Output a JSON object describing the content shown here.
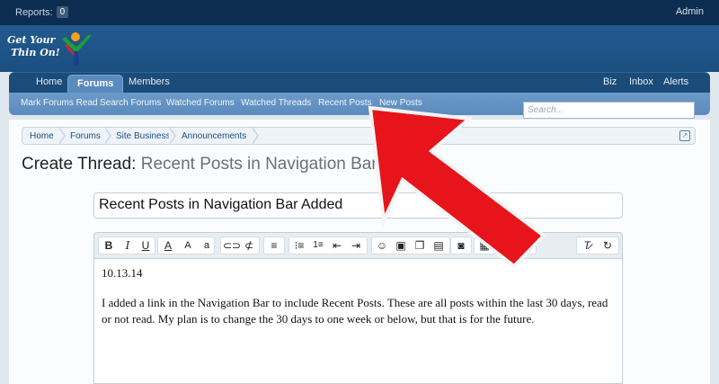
{
  "admin_bar": {
    "reports_label": "Reports:",
    "reports_count": "0",
    "admin_label": "Admin"
  },
  "logo": {
    "line1": "Get Your",
    "line2": "Thin On!"
  },
  "tabs": {
    "home": "Home",
    "forums": "Forums",
    "members": "Members",
    "biz": "Biz",
    "inbox": "Inbox",
    "alerts": "Alerts"
  },
  "subnav": {
    "mark_read": "Mark Forums Read",
    "search_forums": "Search Forums",
    "watched_forums": "Watched Forums",
    "watched_threads": "Watched Threads",
    "recent_posts": "Recent Posts",
    "new_posts": "New Posts"
  },
  "search": {
    "placeholder": "Search..."
  },
  "breadcrumbs": [
    "Home",
    "Forums",
    "Site Business",
    "Announcements"
  ],
  "page_title": {
    "prefix": "Create Thread:",
    "rest": "Recent Posts in Navigation Bar Added"
  },
  "thread_title_value": "Recent Posts in Navigation Bar Added",
  "toolbar_icons": [
    "bold-icon",
    "italic-icon",
    "underline-icon",
    "font-color-icon",
    "font-size-icon",
    "font-family-icon",
    "link-icon",
    "unlink-icon",
    "align-icon",
    "bullet-list-icon",
    "numbered-list-icon",
    "outdent-icon",
    "indent-icon",
    "smilie-icon",
    "image-icon",
    "media-icon",
    "quote-icon",
    "toggle-bbcode-icon",
    "save-draft-icon",
    "undo-icon",
    "remove-format-icon",
    "restore-icon"
  ],
  "toolbar_labels": {
    "bold": "B",
    "italic": "I",
    "underline": "U",
    "font_color": "A",
    "font_size": "A",
    "font_family": "a"
  },
  "editor": {
    "date": "10.13.14",
    "body": "I added a link in the Navigation Bar to include Recent Posts.   These are all posts within the last 30 days, read or not read.  My plan is to change the 30 days to one week or below, but that is for the future."
  },
  "colors": {
    "admin_bar": "#0c2d4f",
    "header": "#1f5587",
    "subnav": "#6493c4",
    "arrow": "#e8141b"
  }
}
